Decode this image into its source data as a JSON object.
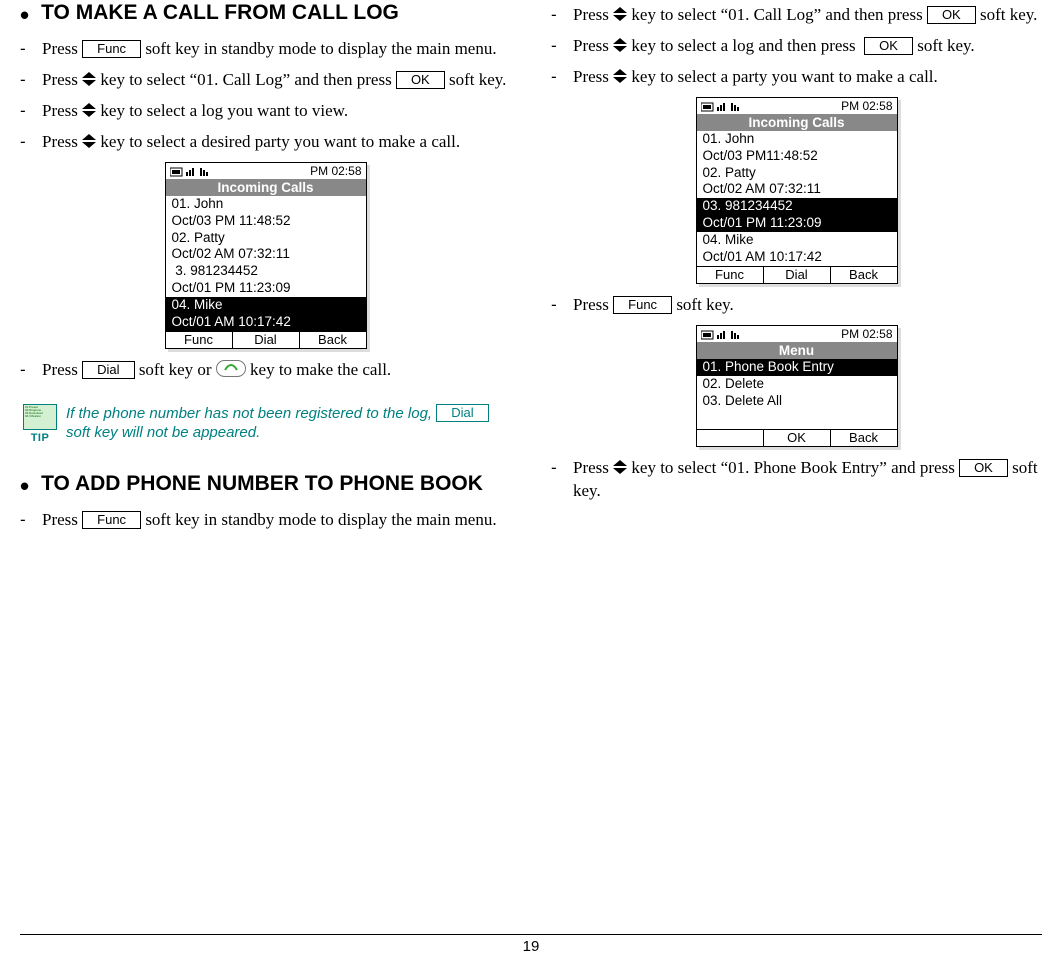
{
  "keys": {
    "func": "Func",
    "ok": "OK",
    "dial": "Dial",
    "back": "Back"
  },
  "left": {
    "h1": "TO MAKE A CALL FROM CALL LOG",
    "s1a": "Press ",
    "s1b": " soft key in standby mode to display the main menu.",
    "s2a": "Press ",
    "s2b": " key to select “01. Call Log” and then press ",
    "s2c": " soft key.",
    "s3a": "Press ",
    "s3b": " key to select a log you want to view.",
    "s4a": "Press ",
    "s4b": " key to select a desired party you want to make a call.",
    "s5a": "Press ",
    "s5b": " soft key or ",
    "s5c": " key to make the call.",
    "tip_a": "If the phone number has not been registered to the log, ",
    "tip_b": " soft key will not be appeared.",
    "tip_label": "TIP",
    "h2": "TO ADD PHONE NUMBER TO PHONE BOOK",
    "s6a": "Press ",
    "s6b": " soft key in standby mode to display the main menu."
  },
  "right": {
    "s1a": "Press ",
    "s1b": " key to select “01. Call Log” and then press ",
    "s1c": " soft key.",
    "s2a": "Press ",
    "s2b": " key to select a log and then press ",
    "s2c": " soft key.",
    "s3a": "Press ",
    "s3b": " key to select a party you want to make a call.",
    "s4a": "Press ",
    "s4b": " soft key.",
    "s5a": "Press ",
    "s5b": " key to select “01. Phone Book Entry” and press ",
    "s5c": " soft key."
  },
  "screen1": {
    "time": "PM 02:58",
    "title": "Incoming Calls",
    "r1": "01. John",
    "r2": "Oct/03 PM 11:48:52",
    "r3": "02. Patty",
    "r4": "Oct/02 AM 07:32:11",
    "r5": " 3. 981234452",
    "r6": "Oct/01 PM 11:23:09",
    "r7": "04. Mike",
    "r8": "Oct/01 AM 10:17:42",
    "sk1": "Func",
    "sk2": "Dial",
    "sk3": "Back"
  },
  "screen2": {
    "time": "PM 02:58",
    "title": "Incoming Calls",
    "r1": "01. John",
    "r2": "Oct/03 PM11:48:52",
    "r3": "02. Patty",
    "r4": "Oct/02 AM 07:32:11",
    "r5": "03. 981234452",
    "r6": "Oct/01 PM 11:23:09",
    "r7": "04. Mike",
    "r8": "Oct/01 AM 10:17:42",
    "sk1": "Func",
    "sk2": "Dial",
    "sk3": "Back"
  },
  "screen3": {
    "time": "PM 02:58",
    "title": "Menu",
    "r1": "01. Phone Book Entry",
    "r2": "02. Delete",
    "r3": "03. Delete All",
    "sk1": "",
    "sk2": "OK",
    "sk3": "Back"
  },
  "page_number": "19"
}
